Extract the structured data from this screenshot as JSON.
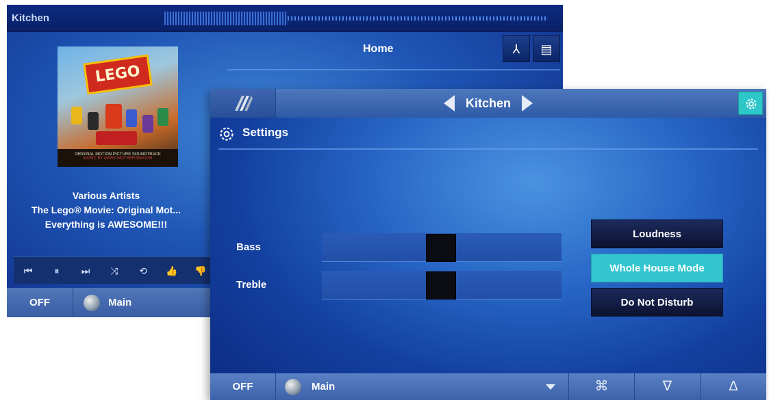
{
  "back_panel": {
    "room": "Kitchen",
    "page_title": "Home",
    "now_playing": {
      "artist": "Various Artists",
      "album": "The Lego® Movie: Original Mot...",
      "song": "Everything is AWESOME!!!"
    },
    "album_art": {
      "logo_text": "LEGO",
      "caption": "ORIGINAL MOTION PICTURE SOUNDTRACK",
      "caption_line2": "MUSIC BY MARK MOTHERSBAUGH"
    },
    "transport": [
      "previous-icon",
      "pause-icon",
      "next-icon",
      "shuffle-icon",
      "repeat-icon",
      "thumbs-up-icon",
      "thumbs-down-icon"
    ],
    "bottom": {
      "power_label": "OFF",
      "source_label": "Main"
    }
  },
  "front_panel": {
    "room": "Kitchen",
    "section_title": "Settings",
    "sliders": [
      {
        "label": "Bass",
        "value": 0.5
      },
      {
        "label": "Treble",
        "value": 0.5
      }
    ],
    "toggles": [
      {
        "label": "Loudness",
        "active": false
      },
      {
        "label": "Whole House Mode",
        "active": true
      },
      {
        "label": "Do Not Disturb",
        "active": false
      }
    ],
    "footer": {
      "power_label": "OFF",
      "source_label": "Main",
      "mute_symbol": "⌘",
      "vol_down_symbol": "∇",
      "vol_up_symbol": "Δ"
    }
  },
  "colors": {
    "accent_teal": "#33c6d0",
    "panel_blue": "#1f55b5",
    "button_dark": "#0c1230"
  }
}
